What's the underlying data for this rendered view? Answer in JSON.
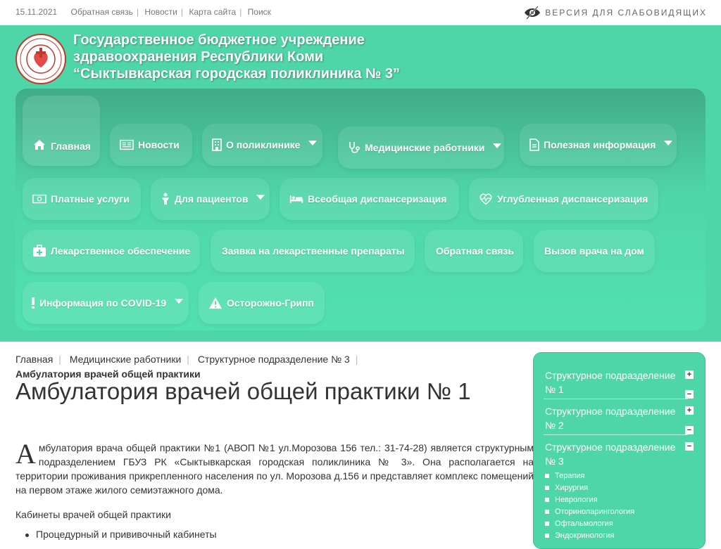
{
  "topbar": {
    "date": "15.11.2021",
    "links": [
      "Обратная связь",
      "Новости",
      "Карта сайта",
      "Поиск"
    ],
    "vision_label": "ВЕРСИЯ ДЛЯ СЛАБОВИДЯЩИХ"
  },
  "header": {
    "org_line1": "Государственное бюджетное учреждение",
    "org_line2": "здравоохранения Республики Коми",
    "org_line3": "“Сыктывкарская городская поликлиника № 3”",
    "accent_color": "#4fd6a8"
  },
  "nav": {
    "items": [
      {
        "label": "Главная",
        "icon": "home-icon"
      },
      {
        "label": "Новости",
        "icon": "newspaper-icon"
      },
      {
        "label": "О поликлинике",
        "icon": "building-icon",
        "dropdown": true
      },
      {
        "label": "Медицинские работники",
        "icon": "stethoscope-icon",
        "dropdown": true
      },
      {
        "label": "Полезная информация",
        "icon": "document-icon",
        "dropdown": true
      },
      {
        "label": "Платные услуги",
        "icon": "banknote-icon"
      },
      {
        "label": "Для пациентов",
        "icon": "person-icon",
        "dropdown": true
      },
      {
        "label": "Всеобщая диспансеризация",
        "icon": "bed-icon"
      },
      {
        "label": "Углубленная диспансеризация",
        "icon": "heartbeat-icon"
      },
      {
        "label": "Лекарственное обеспечение",
        "icon": "medkit-icon"
      },
      {
        "label": "Заявка на лекарственные препараты"
      },
      {
        "label": "Обратная связь"
      },
      {
        "label": "Вызов врача на дом"
      },
      {
        "label": "Информация по COVID-19",
        "icon": "exclamation-icon",
        "dropdown": true
      },
      {
        "label": "Осторожно-Грипп",
        "icon": "warning-icon"
      }
    ]
  },
  "breadcrumb": {
    "items": [
      "Главная",
      "Медицинские работники",
      "Структурное подразделение № 3"
    ],
    "current": "Амбулатория врачей общей практики"
  },
  "main": {
    "title": "Амбулатория врачей общей практики № 1",
    "dropcap": "А",
    "paragraph": "мбулатория врача общей практики №1 (АВОП №1 ул.Морозова 156 тел.: 31-74-28) является структурным подразделением ГБУЗ РК «Сыктывкарская городская поликлиника № 3». Она располагается на территории проживания прикрепленного населения по ул. Морозова д.156 и представляет комплекс помещений на первом этаже жилого семиэтажного дома.",
    "subheading": "Кабинеты врачей общей практики",
    "list": [
      "Процедурный и прививочный кабинеты"
    ]
  },
  "sidebar": {
    "sections": [
      {
        "label": "Структурное подразделение № 1",
        "expanded": false
      },
      {
        "label": "Структурное подразделение № 2",
        "expanded": false
      },
      {
        "label": "Структурное подразделение № 3",
        "expanded": true
      }
    ],
    "subitems": [
      "Терапия",
      "Хирургия",
      "Неврология",
      "Оториноларингология",
      "Офтальмология",
      "Эндокринология"
    ],
    "plus": "+",
    "minus": "−"
  }
}
